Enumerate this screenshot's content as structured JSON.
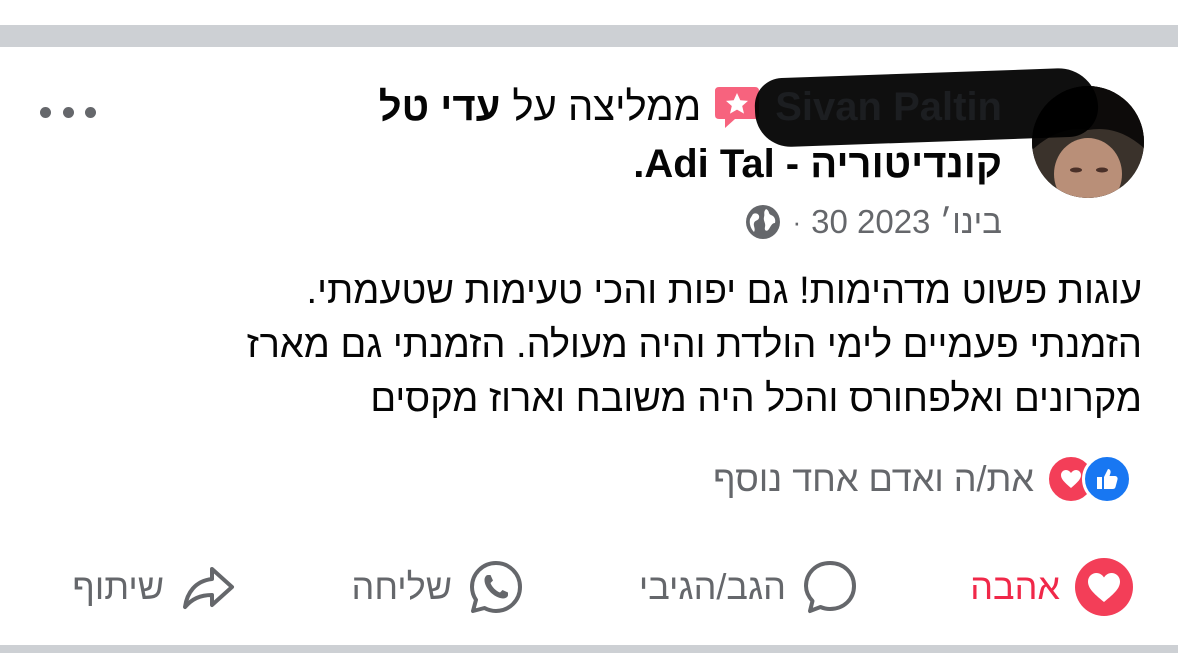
{
  "post": {
    "author_name": "Sivan Paltin",
    "recommends_text": "ממליצה על",
    "page_name_part1": "עדי טל",
    "page_name_part2": "קונדיטוריה - Adi Tal",
    "page_name_suffix": ".",
    "date": "30 בינו׳ 2023",
    "separator": "·",
    "privacy_icon": "globe-icon",
    "body_lines": [
      "עוגות פשוט מדהימות! גם יפות והכי טעימות שטעמתי.",
      "הזמנתי פעמיים לימי הולדת והיה מעולה. הזמנתי גם מארז",
      "מקרונים ואלפחורס והכל היה משובח וארוז מקסים"
    ]
  },
  "reactions": {
    "summary_text": "את/ה ואדם אחד נוסף",
    "icons": [
      "like-icon",
      "love-icon"
    ]
  },
  "actions": {
    "love_label": "אהבה",
    "comment_label": "הגב/הגיבי",
    "send_label": "שליחה",
    "share_label": "שיתוף"
  },
  "colors": {
    "like_blue": "#1877f2",
    "love_red": "#f02849",
    "secondary_text": "#65676b",
    "recommend_badge": "#f7637e"
  }
}
